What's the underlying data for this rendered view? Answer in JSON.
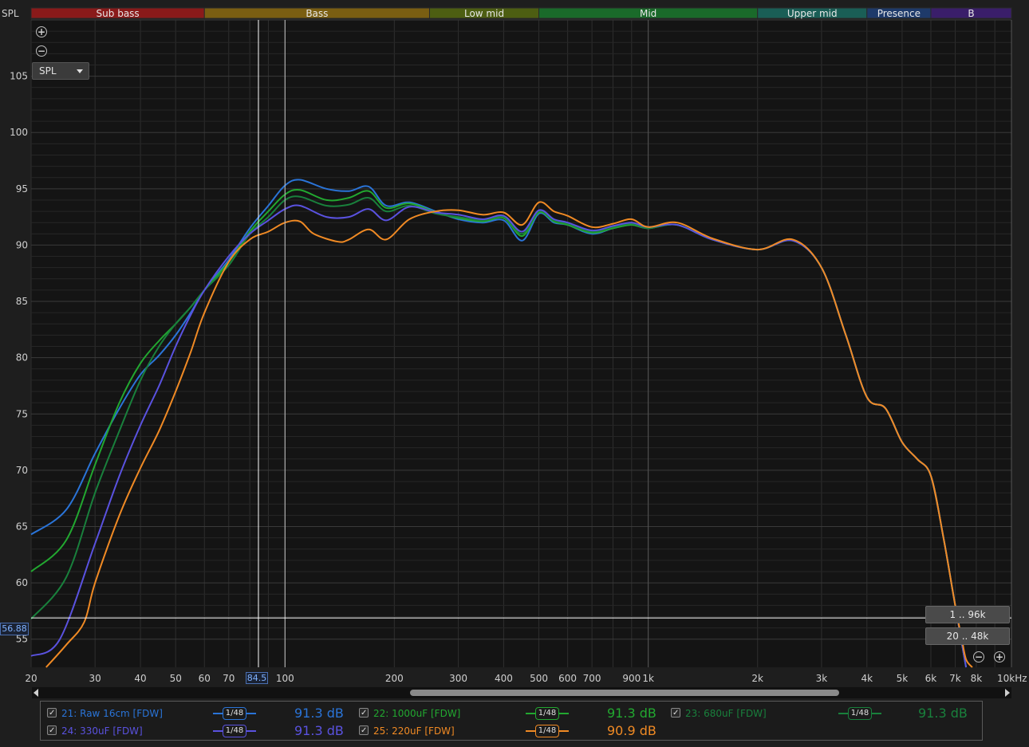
{
  "axis": {
    "y_title": "SPL",
    "x_unit_label": "10kHz"
  },
  "bands": [
    {
      "name": "Sub bass",
      "from": 20,
      "to": 60,
      "color": "#8a1a1a"
    },
    {
      "name": "Bass",
      "from": 60,
      "to": 250,
      "color": "#7a5e12"
    },
    {
      "name": "Low mid",
      "from": 250,
      "to": 500,
      "color": "#4d5e12"
    },
    {
      "name": "Mid",
      "from": 500,
      "to": 2000,
      "color": "#1a6a2a"
    },
    {
      "name": "Upper mid",
      "from": 2000,
      "to": 4000,
      "color": "#1a5e56"
    },
    {
      "name": "Presence",
      "from": 4000,
      "to": 6000,
      "color": "#1e3a6a"
    },
    {
      "name": "B",
      "from": 6000,
      "to": 10000,
      "color": "#3a1e6a"
    }
  ],
  "controls": {
    "zoom_in": "+",
    "zoom_out": "−",
    "spl_select": "SPL",
    "range_btn_1": "1 .. 96k",
    "range_btn_2": "20 .. 48k",
    "cursor_x_value": "84.5",
    "cursor_y_value": "56.88"
  },
  "chart_data": {
    "type": "line",
    "xscale": "log",
    "xlim": [
      20,
      10000
    ],
    "ylim": [
      52.5,
      110
    ],
    "grid": true,
    "y_ticks": [
      55,
      60,
      65,
      70,
      75,
      80,
      85,
      90,
      95,
      100,
      105
    ],
    "x_ticks": [
      {
        "v": 20,
        "label": "20"
      },
      {
        "v": 30,
        "label": "30"
      },
      {
        "v": 40,
        "label": "40"
      },
      {
        "v": 50,
        "label": "50"
      },
      {
        "v": 60,
        "label": "60"
      },
      {
        "v": 70,
        "label": "70"
      },
      {
        "v": 100,
        "label": "100"
      },
      {
        "v": 200,
        "label": "200"
      },
      {
        "v": 300,
        "label": "300"
      },
      {
        "v": 400,
        "label": "400"
      },
      {
        "v": 500,
        "label": "500"
      },
      {
        "v": 600,
        "label": "600"
      },
      {
        "v": 700,
        "label": "700"
      },
      {
        "v": 900,
        "label": "900"
      },
      {
        "v": 1000,
        "label": "1k"
      },
      {
        "v": 2000,
        "label": "2k"
      },
      {
        "v": 3000,
        "label": "3k"
      },
      {
        "v": 4000,
        "label": "4k"
      },
      {
        "v": 5000,
        "label": "5k"
      },
      {
        "v": 6000,
        "label": "6k"
      },
      {
        "v": 7000,
        "label": "7k"
      },
      {
        "v": 8000,
        "label": "8k"
      }
    ],
    "cursor": {
      "x": 84.5,
      "y": 56.88
    },
    "marker_x": 100,
    "series": [
      {
        "name": "21: Raw 16cm [FDW]",
        "color": "#2a74d8",
        "smoothing": "1/48",
        "level": "91.3 dB",
        "points": [
          [
            20,
            64.3
          ],
          [
            25,
            66.5
          ],
          [
            30,
            71.5
          ],
          [
            35,
            75.5
          ],
          [
            40,
            78.5
          ],
          [
            45,
            80.2
          ],
          [
            50,
            82
          ],
          [
            55,
            84
          ],
          [
            60,
            86
          ],
          [
            70,
            88.7
          ],
          [
            80,
            91.5
          ],
          [
            90,
            93.5
          ],
          [
            100,
            95.3
          ],
          [
            110,
            95.8
          ],
          [
            130,
            95
          ],
          [
            150,
            94.8
          ],
          [
            170,
            95.2
          ],
          [
            190,
            93.5
          ],
          [
            220,
            93.8
          ],
          [
            260,
            93
          ],
          [
            300,
            92.3
          ],
          [
            350,
            92
          ],
          [
            400,
            92.2
          ],
          [
            450,
            90.4
          ],
          [
            500,
            92.8
          ],
          [
            550,
            92
          ],
          [
            600,
            91.8
          ],
          [
            700,
            91
          ],
          [
            800,
            91.5
          ],
          [
            900,
            91.8
          ],
          [
            1000,
            91.5
          ],
          [
            1200,
            91.8
          ],
          [
            1500,
            90.5
          ],
          [
            2000,
            89.6
          ],
          [
            2500,
            90.4
          ],
          [
            3000,
            88
          ],
          [
            3500,
            82
          ],
          [
            4000,
            76.5
          ],
          [
            4500,
            75.5
          ],
          [
            5000,
            72.5
          ],
          [
            5500,
            71
          ],
          [
            6000,
            69.5
          ],
          [
            6500,
            64
          ],
          [
            7000,
            58
          ],
          [
            7500,
            52.5
          ]
        ]
      },
      {
        "name": "22: 1000uF [FDW]",
        "color": "#22a830",
        "smoothing": "1/48",
        "level": "91.3 dB",
        "points": [
          [
            20,
            61
          ],
          [
            25,
            63.8
          ],
          [
            30,
            70.5
          ],
          [
            35,
            76
          ],
          [
            40,
            79.5
          ],
          [
            45,
            81.5
          ],
          [
            50,
            83
          ],
          [
            55,
            84.5
          ],
          [
            60,
            86
          ],
          [
            70,
            88.5
          ],
          [
            80,
            91.2
          ],
          [
            90,
            93
          ],
          [
            100,
            94.5
          ],
          [
            110,
            94.9
          ],
          [
            130,
            94
          ],
          [
            150,
            94.2
          ],
          [
            170,
            94.8
          ],
          [
            190,
            93.3
          ],
          [
            220,
            93.7
          ],
          [
            260,
            92.9
          ],
          [
            300,
            92.4
          ],
          [
            350,
            92.1
          ],
          [
            400,
            92.4
          ],
          [
            450,
            90.8
          ],
          [
            500,
            92.9
          ],
          [
            550,
            92.1
          ],
          [
            600,
            91.8
          ],
          [
            700,
            91.1
          ],
          [
            800,
            91.5
          ],
          [
            900,
            91.8
          ],
          [
            1000,
            91.5
          ],
          [
            1200,
            91.8
          ],
          [
            1500,
            90.5
          ],
          [
            2000,
            89.6
          ],
          [
            2500,
            90.4
          ],
          [
            3000,
            88
          ],
          [
            3500,
            82
          ],
          [
            4000,
            76.5
          ],
          [
            4500,
            75.5
          ],
          [
            5000,
            72.5
          ],
          [
            5500,
            71
          ],
          [
            6000,
            69.5
          ],
          [
            6500,
            64
          ],
          [
            7000,
            58
          ],
          [
            7500,
            52.5
          ]
        ]
      },
      {
        "name": "23: 680uF [FDW]",
        "color": "#19803c",
        "smoothing": "1/48",
        "level": "91.3 dB",
        "points": [
          [
            20,
            56.8
          ],
          [
            25,
            60.5
          ],
          [
            30,
            68
          ],
          [
            35,
            73.5
          ],
          [
            40,
            78
          ],
          [
            45,
            81
          ],
          [
            50,
            83
          ],
          [
            55,
            84.5
          ],
          [
            60,
            86
          ],
          [
            70,
            88.2
          ],
          [
            80,
            91
          ],
          [
            90,
            92.5
          ],
          [
            100,
            94
          ],
          [
            110,
            94.3
          ],
          [
            130,
            93.5
          ],
          [
            150,
            93.6
          ],
          [
            170,
            94.2
          ],
          [
            190,
            93
          ],
          [
            220,
            93.5
          ],
          [
            260,
            92.8
          ],
          [
            300,
            92.5
          ],
          [
            350,
            92.2
          ],
          [
            400,
            92.5
          ],
          [
            450,
            91
          ],
          [
            500,
            93
          ],
          [
            550,
            92.2
          ],
          [
            600,
            91.9
          ],
          [
            700,
            91.2
          ],
          [
            800,
            91.6
          ],
          [
            900,
            91.9
          ],
          [
            1000,
            91.5
          ],
          [
            1200,
            91.8
          ],
          [
            1500,
            90.5
          ],
          [
            2000,
            89.6
          ],
          [
            2500,
            90.4
          ],
          [
            3000,
            88
          ],
          [
            3500,
            82
          ],
          [
            4000,
            76.5
          ],
          [
            4500,
            75.5
          ],
          [
            5000,
            72.5
          ],
          [
            5500,
            71
          ],
          [
            6000,
            69.5
          ],
          [
            6500,
            64
          ],
          [
            7000,
            58
          ],
          [
            7500,
            52.5
          ]
        ]
      },
      {
        "name": "24: 330uF [FDW]",
        "color": "#5a52e0",
        "smoothing": "1/48",
        "level": "91.3 dB",
        "points": [
          [
            20,
            53.5
          ],
          [
            24,
            55
          ],
          [
            30,
            63.5
          ],
          [
            35,
            69.5
          ],
          [
            40,
            74
          ],
          [
            45,
            77.5
          ],
          [
            50,
            81
          ],
          [
            55,
            83.8
          ],
          [
            60,
            86
          ],
          [
            70,
            89
          ],
          [
            80,
            91
          ],
          [
            90,
            92.2
          ],
          [
            100,
            93.2
          ],
          [
            110,
            93.5
          ],
          [
            130,
            92.5
          ],
          [
            150,
            92.5
          ],
          [
            170,
            93.2
          ],
          [
            190,
            92.2
          ],
          [
            220,
            93.4
          ],
          [
            260,
            92.9
          ],
          [
            300,
            92.7
          ],
          [
            350,
            92.3
          ],
          [
            400,
            92.6
          ],
          [
            450,
            91.2
          ],
          [
            500,
            93.1
          ],
          [
            550,
            92.3
          ],
          [
            600,
            92
          ],
          [
            700,
            91.3
          ],
          [
            800,
            91.7
          ],
          [
            900,
            92
          ],
          [
            1000,
            91.6
          ],
          [
            1200,
            91.8
          ],
          [
            1500,
            90.5
          ],
          [
            2000,
            89.6
          ],
          [
            2500,
            90.4
          ],
          [
            3000,
            88
          ],
          [
            3500,
            82
          ],
          [
            4000,
            76.5
          ],
          [
            4500,
            75.5
          ],
          [
            5000,
            72.5
          ],
          [
            5500,
            71
          ],
          [
            6000,
            69.5
          ],
          [
            6500,
            64
          ],
          [
            7000,
            58
          ],
          [
            7500,
            52.5
          ]
        ]
      },
      {
        "name": "25: 220uF [FDW]",
        "color": "#f08a24",
        "smoothing": "1/48",
        "level": "90.9 dB",
        "points": [
          [
            22,
            52.5
          ],
          [
            25,
            54.5
          ],
          [
            28,
            56.5
          ],
          [
            30,
            60
          ],
          [
            35,
            66
          ],
          [
            40,
            70.2
          ],
          [
            45,
            73.5
          ],
          [
            50,
            77
          ],
          [
            55,
            80.5
          ],
          [
            60,
            84
          ],
          [
            70,
            88.5
          ],
          [
            80,
            90.5
          ],
          [
            90,
            91.2
          ],
          [
            100,
            92
          ],
          [
            110,
            92.1
          ],
          [
            120,
            91
          ],
          [
            140,
            90.3
          ],
          [
            150,
            90.5
          ],
          [
            170,
            91.4
          ],
          [
            190,
            90.5
          ],
          [
            220,
            92.3
          ],
          [
            260,
            93
          ],
          [
            300,
            93.1
          ],
          [
            350,
            92.7
          ],
          [
            400,
            92.9
          ],
          [
            450,
            91.8
          ],
          [
            500,
            93.8
          ],
          [
            550,
            93
          ],
          [
            600,
            92.6
          ],
          [
            700,
            91.6
          ],
          [
            800,
            91.9
          ],
          [
            900,
            92.3
          ],
          [
            1000,
            91.6
          ],
          [
            1200,
            92
          ],
          [
            1500,
            90.6
          ],
          [
            2000,
            89.6
          ],
          [
            2500,
            90.5
          ],
          [
            3000,
            88
          ],
          [
            3500,
            82
          ],
          [
            4000,
            76.5
          ],
          [
            4500,
            75.5
          ],
          [
            5000,
            72.5
          ],
          [
            5500,
            71
          ],
          [
            6000,
            69.5
          ],
          [
            6500,
            64
          ],
          [
            7000,
            58
          ],
          [
            7300,
            55
          ],
          [
            7500,
            53.2
          ],
          [
            7800,
            52.5
          ]
        ]
      }
    ]
  },
  "legend": [
    {
      "name": "21: Raw 16cm [FDW]",
      "color": "#2a74d8",
      "smoothing": "1/48",
      "level": "91.3 dB"
    },
    {
      "name": "22: 1000uF [FDW]",
      "color": "#22a830",
      "smoothing": "1/48",
      "level": "91.3 dB"
    },
    {
      "name": "23: 680uF [FDW]",
      "color": "#19803c",
      "smoothing": "1/48",
      "level": "91.3 dB"
    },
    {
      "name": "24: 330uF [FDW]",
      "color": "#5a52e0",
      "smoothing": "1/48",
      "level": "91.3 dB"
    },
    {
      "name": "25: 220uF [FDW]",
      "color": "#f08a24",
      "smoothing": "1/48",
      "level": "90.9 dB"
    }
  ]
}
